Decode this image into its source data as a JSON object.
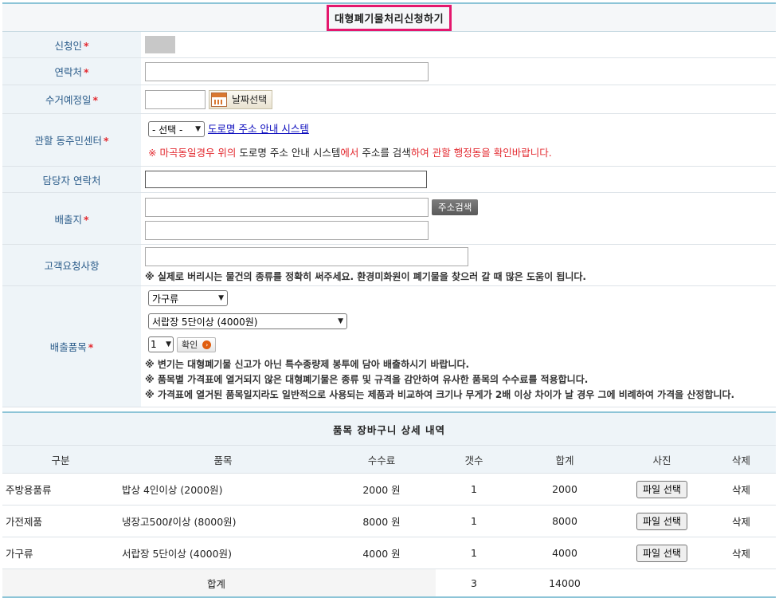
{
  "form": {
    "title": "대형폐기물처리신청하기",
    "required_mark": "*",
    "applicant_label": "신청인",
    "contact_label": "연락처",
    "pickup_label": "수거예정일",
    "date_button": "날짜선택",
    "center_label": "관할 동주민센터",
    "center_select": "- 선택 -",
    "road_link": "도로명 주소 안내 시스템",
    "center_note": {
      "p1": "※ 마곡동",
      "p2": "일경우 위의 ",
      "p3": "도로명 주소 안내 시스템",
      "p4": "에서 ",
      "p5": "주소를 검색",
      "p6": "하여 관할 행정동을 확인바랍니다."
    },
    "manager_label": "담당자 연락처",
    "discharge_label": "배출지",
    "address_search_button": "주소검색",
    "request_label": "고객요청사항",
    "request_note": "※ 실제로 버리시는 물건의 종류를 정확히 써주세요. 환경미화원이 폐기물을 찾으러 갈 때 많은 도움이 됩니다.",
    "items_label": "배출품목",
    "category_select": "가구류",
    "item_select": "서랍장 5단이상 (4000원)",
    "qty_select": "1",
    "confirm_button": "확인",
    "notes": [
      "※ 변기는 대형폐기물 신고가 아닌 특수종량제 봉투에 담아 배출하시기 바랍니다.",
      "※ 품목별 가격표에 열거되지 않은 대형폐기물은 종류 및 규격을 감안하여 유사한 품목의 수수료를 적용합니다.",
      "※ 가격표에 열거된 품목일지라도 일반적으로 사용되는 제품과 비교하여 크기나 무게가 2배 이상 차이가 날 경우 그에 비례하여 가격을 산정합니다."
    ]
  },
  "cart": {
    "title": "품목 장바구니 상세 내역",
    "headers": [
      "구분",
      "품목",
      "수수료",
      "갯수",
      "합계",
      "사진",
      "삭제"
    ],
    "rows": [
      {
        "category": "주방용품류",
        "item": "밥상 4인이상 (2000원)",
        "fee": "2000 원",
        "count": "1",
        "total": "2000",
        "file": "파일 선택",
        "delete": "삭제"
      },
      {
        "category": "가전제품",
        "item": "냉장고500ℓ이상 (8000원)",
        "fee": "8000 원",
        "count": "1",
        "total": "8000",
        "file": "파일 선택",
        "delete": "삭제"
      },
      {
        "category": "가구류",
        "item": "서랍장 5단이상 (4000원)",
        "fee": "4000 원",
        "count": "1",
        "total": "4000",
        "file": "파일 선택",
        "delete": "삭제"
      }
    ],
    "sum_label": "합계",
    "sum_count": "3",
    "sum_total": "14000"
  }
}
